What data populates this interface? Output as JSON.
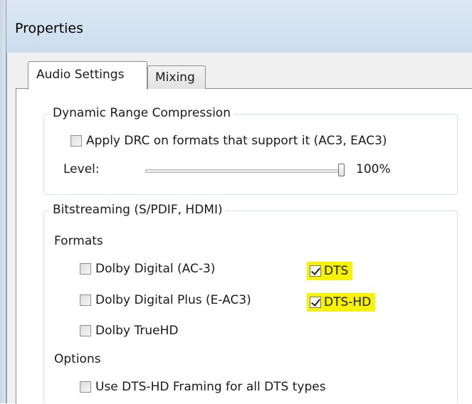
{
  "window": {
    "title": "Properties"
  },
  "tabs": {
    "audio_settings": "Audio Settings",
    "mixing": "Mixing"
  },
  "drc": {
    "legend": "Dynamic Range Compression",
    "apply_label": "Apply DRC on formats that support it (AC3, EAC3)",
    "apply_checked": false,
    "level_label": "Level:",
    "level_value": "100%",
    "level_fraction": 1.0
  },
  "bitstreaming": {
    "legend": "Bitstreaming (S/PDIF, HDMI)",
    "formats_label": "Formats",
    "formats": {
      "dolby_digital": {
        "label": "Dolby Digital (AC-3)",
        "checked": false
      },
      "dolby_digital_plus": {
        "label": "Dolby Digital Plus (E-AC3)",
        "checked": false
      },
      "dolby_truehd": {
        "label": "Dolby TrueHD",
        "checked": false
      },
      "dts": {
        "label": "DTS",
        "checked": true
      },
      "dts_hd": {
        "label": "DTS-HD",
        "checked": true
      }
    },
    "options_label": "Options",
    "options": {
      "dts_hd_framing": {
        "label": "Use DTS-HD Framing for all DTS types",
        "checked": false
      }
    }
  },
  "colors": {
    "highlight": "#f6f200",
    "panel_bg": "#f0f0f0",
    "title_bar": "#d3e1f0"
  }
}
